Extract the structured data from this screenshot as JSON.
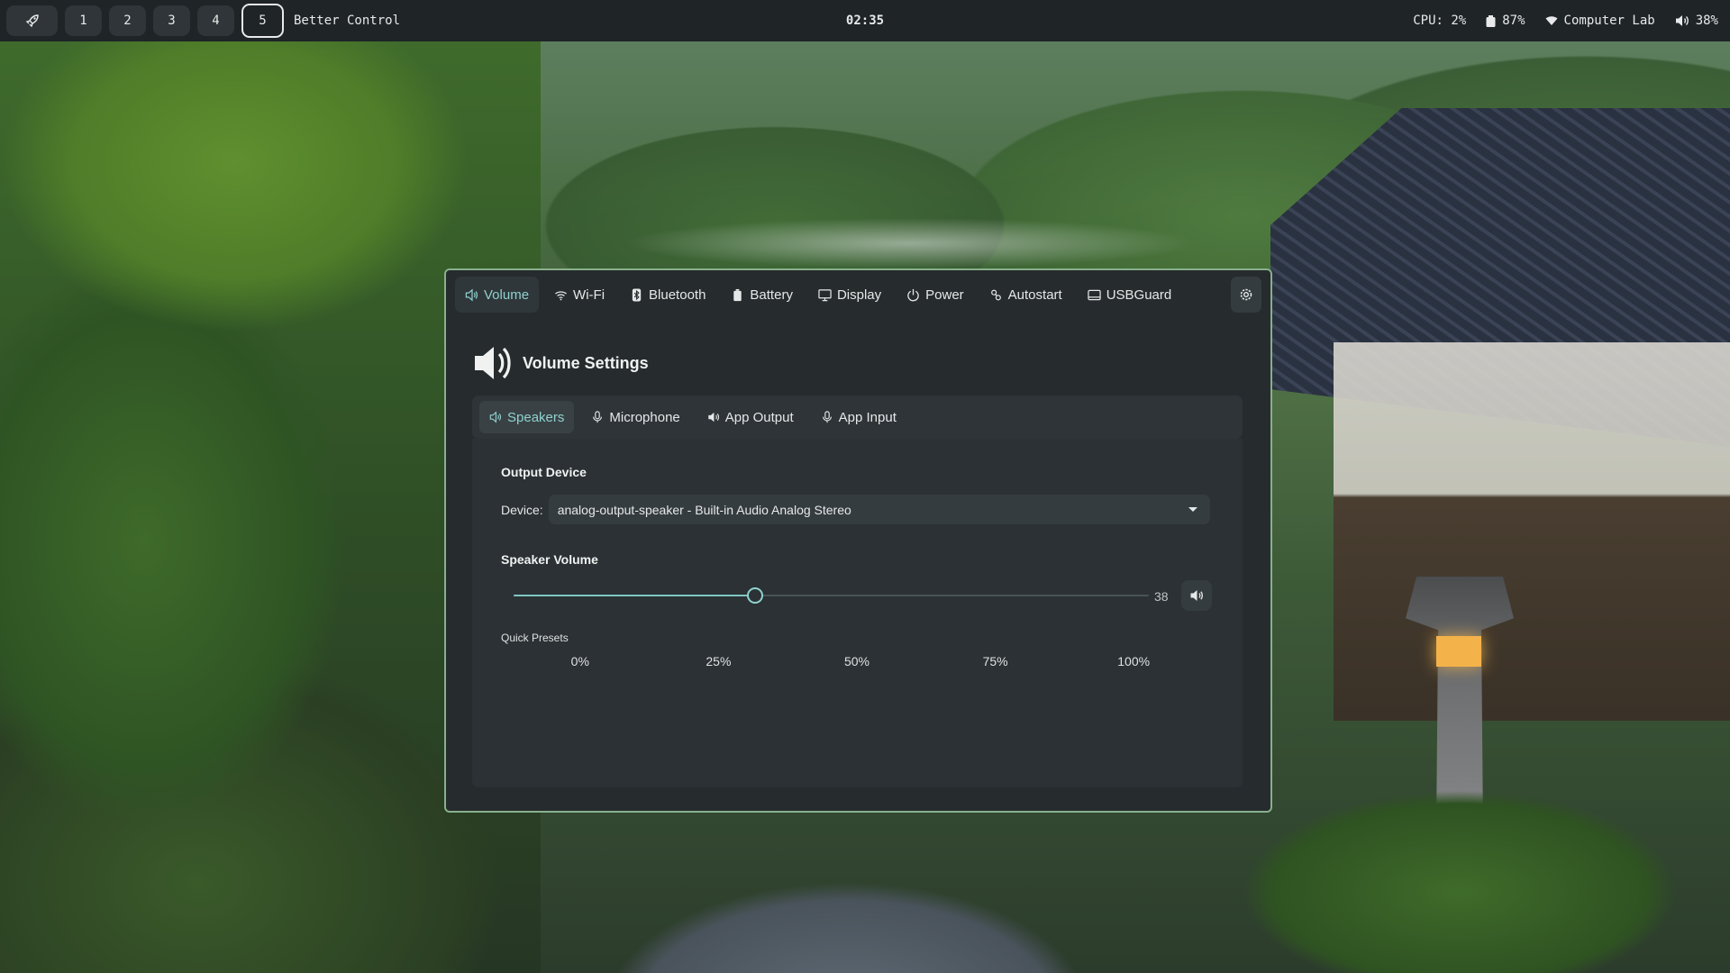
{
  "topbar": {
    "launcher_icon": "rocket-icon",
    "workspaces": [
      "1",
      "2",
      "3",
      "4",
      "5"
    ],
    "active_workspace": "5",
    "window_title": "Better Control",
    "clock": "02:35",
    "cpu": "CPU: 2%",
    "battery": "87%",
    "battery_icon": "battery-icon",
    "wifi": "Computer Lab",
    "wifi_icon": "wifi-icon",
    "volume": "38%",
    "volume_icon": "speaker-icon"
  },
  "window": {
    "tabs": [
      {
        "label": "Volume",
        "icon": "speaker-icon",
        "active": true
      },
      {
        "label": "Wi-Fi",
        "icon": "wifi-icon",
        "active": false
      },
      {
        "label": "Bluetooth",
        "icon": "bluetooth-icon",
        "active": false
      },
      {
        "label": "Battery",
        "icon": "battery-icon",
        "active": false
      },
      {
        "label": "Display",
        "icon": "monitor-icon",
        "active": false
      },
      {
        "label": "Power",
        "icon": "power-icon",
        "active": false
      },
      {
        "label": "Autostart",
        "icon": "autostart-icon",
        "active": false
      },
      {
        "label": "USBGuard",
        "icon": "usb-icon",
        "active": false
      }
    ],
    "settings_icon": "gear-icon",
    "panel_title": "Volume Settings",
    "subtabs": [
      {
        "label": "Speakers",
        "icon": "speaker-icon",
        "active": true
      },
      {
        "label": "Microphone",
        "icon": "microphone-icon",
        "active": false
      },
      {
        "label": "App Output",
        "icon": "speaker-icon",
        "active": false
      },
      {
        "label": "App Input",
        "icon": "microphone-icon",
        "active": false
      }
    ],
    "output_device": {
      "heading": "Output Device",
      "device_label": "Device:",
      "selected": "analog-output-speaker - Built-in Audio Analog Stereo"
    },
    "speaker_volume": {
      "heading": "Speaker Volume",
      "value": 38,
      "value_text": "38",
      "min": 0,
      "max": 100
    },
    "quick_presets": {
      "label": "Quick Presets",
      "options": [
        "0%",
        "25%",
        "50%",
        "75%",
        "100%"
      ]
    }
  },
  "colors": {
    "accent": "#8fd1cf",
    "window_border": "#88b08c",
    "window_bg": "#262b2d",
    "topbar_bg": "#1f2427"
  }
}
